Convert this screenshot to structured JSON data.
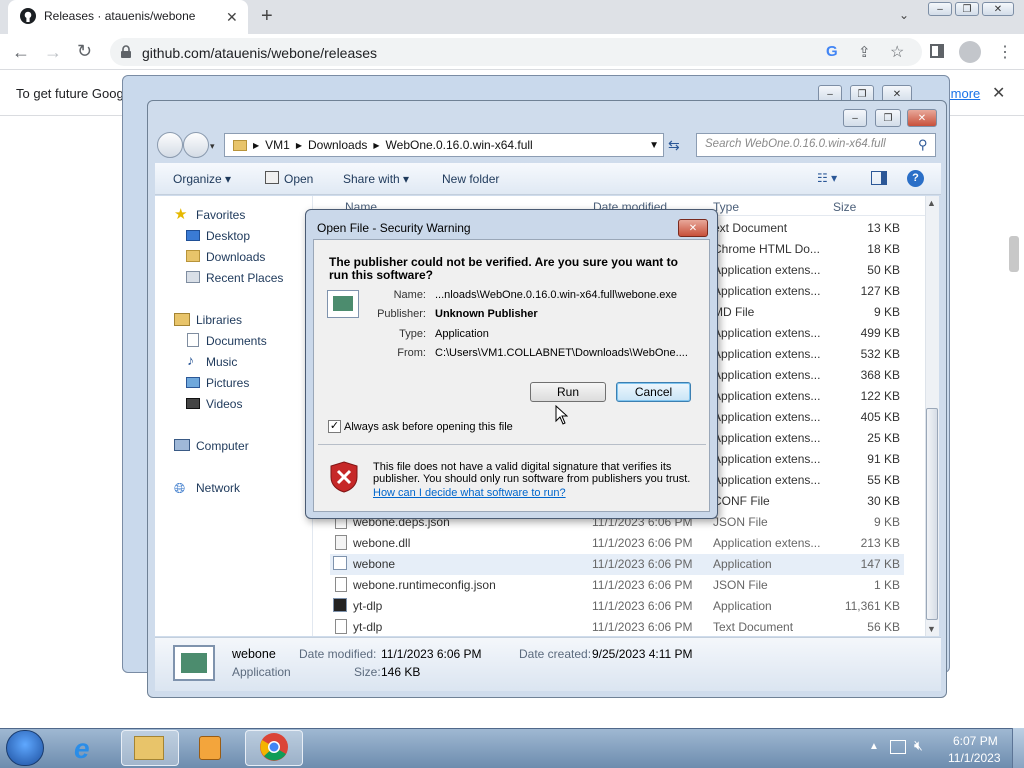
{
  "browser": {
    "tab_title": "Releases · atauenis/webone",
    "url": "github.com/atauenis/webone/releases",
    "infobar_text": "To get future Goog",
    "infobar_link": "earn more"
  },
  "explorer": {
    "breadcrumb": [
      "VM1",
      "Downloads",
      "WebOne.0.16.0.win-x64.full"
    ],
    "search_placeholder": "Search WebOne.0.16.0.win-x64.full",
    "toolbar": {
      "organize": "Organize",
      "open": "Open",
      "share_with": "Share with",
      "new_folder": "New folder"
    },
    "columns": {
      "name": "Name",
      "date_modified": "Date modified",
      "type": "Type",
      "size": "Size"
    },
    "nav": {
      "favorites": "Favorites",
      "desktop": "Desktop",
      "downloads": "Downloads",
      "recent": "Recent Places",
      "libraries": "Libraries",
      "documents": "Documents",
      "music": "Music",
      "pictures": "Pictures",
      "videos": "Videos",
      "computer": "Computer",
      "network": "Network"
    },
    "partial_rows": [
      {
        "type": "ext Document",
        "size": "13 KB"
      },
      {
        "type": "Chrome HTML Do...",
        "size": "18 KB"
      },
      {
        "type": "Application extens...",
        "size": "50 KB"
      },
      {
        "type": "Application extens...",
        "size": "127 KB"
      },
      {
        "type": "MD File",
        "size": "9 KB"
      },
      {
        "type": "Application extens...",
        "size": "499 KB"
      },
      {
        "type": "Application extens...",
        "size": "532 KB"
      },
      {
        "type": "Application extens...",
        "size": "368 KB"
      },
      {
        "type": "Application extens...",
        "size": "122 KB"
      },
      {
        "type": "Application extens...",
        "size": "405 KB"
      },
      {
        "type": "Application extens...",
        "size": "25 KB"
      },
      {
        "type": "Application extens...",
        "size": "91 KB"
      },
      {
        "type": "Application extens...",
        "size": "55 KB"
      },
      {
        "type": "CONF File",
        "size": "30 KB"
      }
    ],
    "rows": [
      {
        "name": "webone.deps.json",
        "date": "11/1/2023 6:06 PM",
        "type": "JSON File",
        "size": "9 KB"
      },
      {
        "name": "webone.dll",
        "date": "11/1/2023 6:06 PM",
        "type": "Application extens...",
        "size": "213 KB"
      },
      {
        "name": "webone",
        "date": "11/1/2023 6:06 PM",
        "type": "Application",
        "size": "147 KB"
      },
      {
        "name": "webone.runtimeconfig.json",
        "date": "11/1/2023 6:06 PM",
        "type": "JSON File",
        "size": "1 KB"
      },
      {
        "name": "yt-dlp",
        "date": "11/1/2023 6:06 PM",
        "type": "Application",
        "size": "11,361 KB"
      },
      {
        "name": "yt-dlp",
        "date": "11/1/2023 6:06 PM",
        "type": "Text Document",
        "size": "56 KB"
      }
    ],
    "status": {
      "name": "webone",
      "kind": "Application",
      "date_modified_label": "Date modified:",
      "date_modified": "11/1/2023 6:06 PM",
      "date_created_label": "Date created:",
      "date_created": "9/25/2023 4:11 PM",
      "size_label": "Size:",
      "size": "146 KB"
    }
  },
  "dialog": {
    "title": "Open File - Security Warning",
    "question": "The publisher could not be verified.  Are you sure you want to run this software?",
    "name_label": "Name:",
    "name_value": "...nloads\\WebOne.0.16.0.win-x64.full\\webone.exe",
    "publisher_label": "Publisher:",
    "publisher_value": "Unknown Publisher",
    "type_label": "Type:",
    "type_value": "Application",
    "from_label": "From:",
    "from_value": "C:\\Users\\VM1.COLLABNET\\Downloads\\WebOne....",
    "run": "Run",
    "cancel": "Cancel",
    "checkbox_label": "Always ask before opening this file",
    "warning_text": "This file does not have a valid digital signature that verifies its publisher.  You should only run software from publishers you trust.",
    "help_link": "How can I decide what software to run?"
  },
  "taskbar": {
    "time": "6:07 PM",
    "date": "11/1/2023"
  },
  "colors": {
    "dialog_border": "#4a5b73",
    "link": "#0066cc",
    "selected_row": "#e6eef8"
  }
}
